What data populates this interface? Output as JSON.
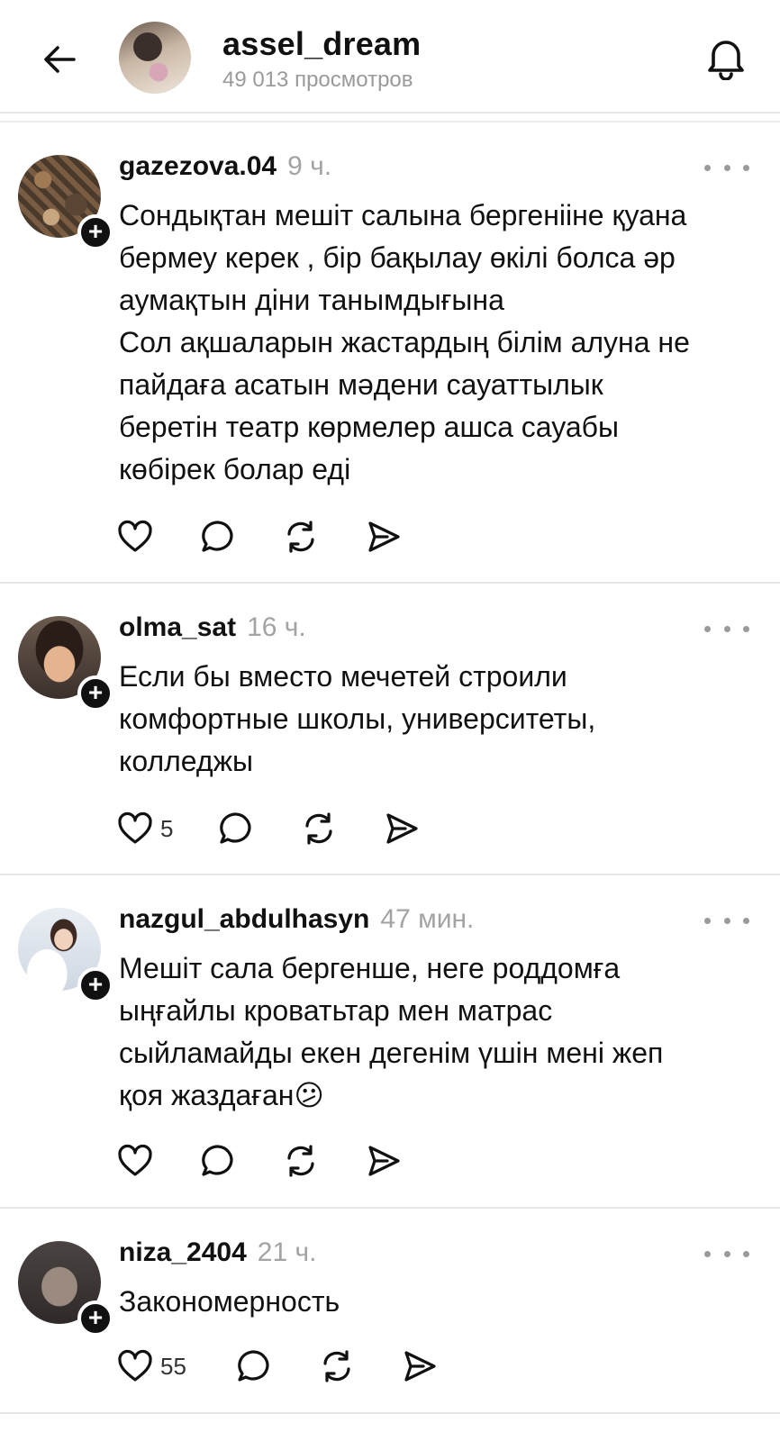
{
  "header": {
    "title": "assel_dream",
    "views": "49 013 просмотров"
  },
  "comments": [
    {
      "username": "gazezova.04",
      "time": "9 ч.",
      "lines": [
        "Сондықтан мешіт салына бергенііне қуана",
        "бермеу керек , бір бақылау өкілі болса әр",
        "аумақтын діни танымдығына",
        "Сол ақшаларын жастардың білім алуна не",
        "пайдаға асатын мәдени сауаттылык",
        "беретін театр көрмелер ашса сауабы",
        "көбірек болар еді"
      ],
      "likes": ""
    },
    {
      "username": "olma_sat",
      "time": "16 ч.",
      "lines": [
        "Если бы вместо мечетей строили",
        "комфортные школы, университеты,",
        "колледжы"
      ],
      "likes": "5"
    },
    {
      "username": "nazgul_abdulhasyn",
      "time": "47 мин.",
      "lines": [
        "Мешіт сала бергенше, неге роддомға",
        "ыңғайлы кроватьтар мен матрас",
        "сыйламайды екен дегенім үшін мені жеп",
        "қоя жаздаған😕"
      ],
      "likes": ""
    },
    {
      "username": "niza_2404",
      "time": "21 ч.",
      "lines": [
        "Закономерность"
      ],
      "likes": "55"
    }
  ],
  "icons": {
    "back": "arrow-left-icon",
    "bell": "bell-icon",
    "more": "more-horizontal-icon",
    "like": "heart-icon",
    "reply": "comment-bubble-icon",
    "repost": "repost-icon",
    "share": "send-icon",
    "follow": "plus-badge-icon"
  },
  "colors": {
    "text": "#111111",
    "muted": "#a3a3a3",
    "divider": "#e6e6e6",
    "badge": "#111111"
  }
}
